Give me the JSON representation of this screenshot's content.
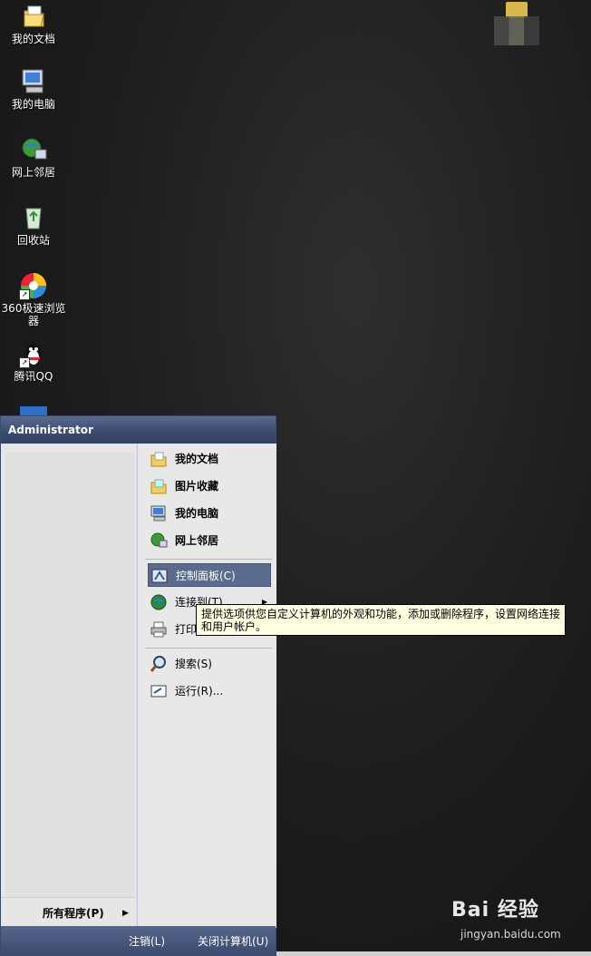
{
  "desktop": {
    "icons": [
      {
        "label": "我的文档",
        "icon": "my-documents-icon"
      },
      {
        "label": "我的电脑",
        "icon": "my-computer-icon"
      },
      {
        "label": "网上邻居",
        "icon": "network-places-icon"
      },
      {
        "label": "回收站",
        "icon": "recycle-bin-icon"
      },
      {
        "label": "360极速浏览器",
        "icon": "360-browser-icon"
      },
      {
        "label": "腾讯QQ",
        "icon": "qq-icon"
      }
    ]
  },
  "start_menu": {
    "user": "Administrator",
    "all_programs": "所有程序(P)",
    "right_items": [
      {
        "label": "我的文档",
        "icon": "my-documents-icon"
      },
      {
        "label": "图片收藏",
        "icon": "my-pictures-icon"
      },
      {
        "label": "我的电脑",
        "icon": "my-computer-icon"
      },
      {
        "label": "网上邻居",
        "icon": "network-places-icon"
      },
      {
        "label": "控制面板(C)",
        "icon": "control-panel-icon"
      },
      {
        "label": "连接到(T)",
        "icon": "connect-to-icon"
      },
      {
        "label": "打印",
        "icon": "printer-icon"
      },
      {
        "label": "搜索(S)",
        "icon": "search-icon"
      },
      {
        "label": "运行(R)...",
        "icon": "run-icon"
      }
    ],
    "logoff": "注销(L)",
    "shutdown": "关闭计算机(U)"
  },
  "tooltip": "提供选项供您自定义计算机的外观和功能，添加或删除程序，设置网络连接和用户帐户。",
  "watermark": {
    "brand": "Bai 经验",
    "url": "jingyan.baidu.com"
  },
  "colors": {
    "highlight": "#5a6b8d",
    "header": "#3b4a6e",
    "tooltip_bg": "#ffffe1"
  }
}
